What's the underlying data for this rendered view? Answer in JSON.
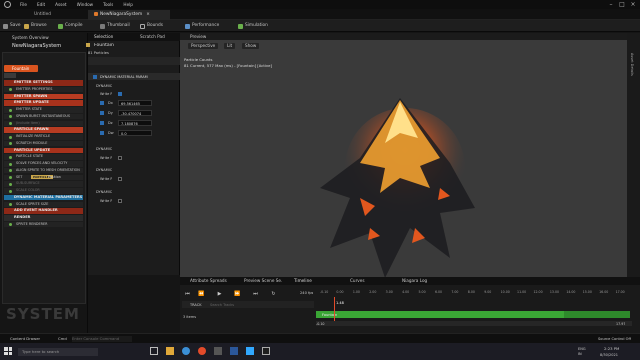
{
  "menubar": {
    "items": [
      "File",
      "Edit",
      "Asset",
      "Window",
      "Tools",
      "Help"
    ]
  },
  "tabs": {
    "untitled": "Untitled",
    "editor": "NewNiagaraSystem"
  },
  "toolbar": {
    "save": "Save",
    "browse": "Browse",
    "compile": "Compile",
    "thumbnail": "Thumbnail",
    "bounds": "Bounds",
    "performance": "Performance",
    "simulation": "Simulation"
  },
  "system_overview": {
    "tab_label": "System Overview",
    "system_name": "NewNiagaraSystem",
    "emitter_name": "Fountain",
    "watermark": "SYSTEM",
    "stack": [
      {
        "label": "EMITTER SETTINGS",
        "kind": "emitter"
      },
      {
        "label": "EMITTER PROPERTIES",
        "kind": "module"
      },
      {
        "label": "EMITTER SPAWN",
        "kind": "spawn"
      },
      {
        "label": "EMITTER UPDATE",
        "kind": "update"
      },
      {
        "label": "EMITTER STATE",
        "kind": "module"
      },
      {
        "label": "SPAWN BURST INSTANTANEOUS",
        "kind": "module"
      },
      {
        "label": "(include item)",
        "kind": "dim"
      },
      {
        "label": "PARTICLE SPAWN",
        "kind": "spawn"
      },
      {
        "label": "INITIALIZE PARTICLE",
        "kind": "module"
      },
      {
        "label": "SCRATCH MODULE",
        "kind": "module"
      },
      {
        "label": "PARTICLE UPDATE",
        "kind": "update"
      },
      {
        "label": "PARTICLE STATE",
        "kind": "module"
      },
      {
        "label": "SOLVE FORCES AND VELOCITY",
        "kind": "module"
      },
      {
        "label": "ALIGN SPRITE TO MESH ORIENTATION",
        "kind": "module"
      },
      {
        "label": "SET",
        "kind": "module"
      },
      {
        "label": "SUB-SURFACE",
        "kind": "dim"
      },
      {
        "label": "SCALE COLOR",
        "kind": "dim"
      },
      {
        "label": "DYNAMIC MATERIAL PARAMETERS",
        "kind": "selected"
      },
      {
        "label": "SCALE SPRITE SIZE",
        "kind": "module"
      },
      {
        "label": "ADD EVENT HANDLER",
        "kind": "emitter"
      },
      {
        "label": "RENDER",
        "kind": "render"
      },
      {
        "label": "SPRITE RENDERER",
        "kind": "module"
      }
    ],
    "set_badge": "PARTICLES",
    "set_value": "Position"
  },
  "selection": {
    "tab_label": "Selection",
    "scratch_tab": "Scratch Pad",
    "emitter": "Fountain",
    "subtitle": "81 Particles",
    "module_header": "DYNAMIC MATERIAL PARAM",
    "group1": "DYNAMIC",
    "write_label": "Write P",
    "params": [
      {
        "label": "Dx",
        "value": "69.561465"
      },
      {
        "label": "Dy",
        "value": "-30.470074"
      },
      {
        "label": "Dz",
        "value": "7.180876"
      },
      {
        "label": "Dw",
        "value": "0.0"
      }
    ],
    "group2": "DYNAMIC",
    "group3": "DYNAMIC",
    "group4": "DYNAMIC",
    "write2": "Write P",
    "write3": "Write P",
    "write4": "Write P"
  },
  "preview": {
    "tab_label": "Preview",
    "perspective": "Perspective",
    "lit": "Lit",
    "show": "Show",
    "stats_title": "Particle Counts",
    "stats_line": "81 Current, 577 Max (ms) - [Fountain] [Active]",
    "right_label": "Asset Details"
  },
  "bottom": {
    "tabs": [
      "Attribute Spreads",
      "Preview Scene Se.",
      "Timeline",
      "Curves",
      "Niagara Log"
    ],
    "fps": "240 fps",
    "track_label": "TRACK",
    "search_placeholder": "Search Tracks",
    "items_count": "3 items",
    "track_name": "Fountain",
    "playhead": "1.48",
    "range_start": "-0.10",
    "range_end": "17.97",
    "ticks": [
      "-0.10",
      "0.00",
      "1.00",
      "2.00",
      "3.00",
      "4.00",
      "5.00",
      "6.00",
      "7.00",
      "8.00",
      "9.00",
      "10.00",
      "11.00",
      "12.00",
      "13.00",
      "14.00",
      "15.00",
      "16.00",
      "17.00"
    ]
  },
  "status": {
    "content_drawer": "Content Drawer",
    "cmd": "Cmd",
    "console_placeholder": "Enter Console Command",
    "source_control": "Source Control Off"
  },
  "taskbar": {
    "search_placeholder": "Type here to search",
    "lang": "ENG",
    "region": "IN",
    "time": "2:23 PM",
    "date": "8/30/2021"
  },
  "colors": {
    "accent_blue": "#1e6f9f",
    "spawn_orange": "#b83c22",
    "timeline_green": "#3aa635"
  }
}
